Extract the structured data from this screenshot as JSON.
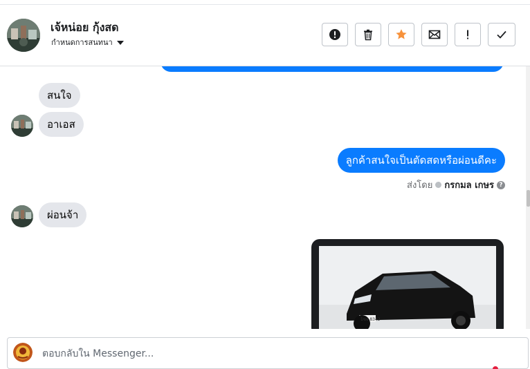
{
  "header": {
    "contact_name": "เจ้หน่อย กุ้งสด",
    "assign_label": "กำหนดการสนทนา"
  },
  "toolbar": {
    "buttons": [
      {
        "name": "follow-up-button",
        "icon": "alert-circle-icon"
      },
      {
        "name": "delete-button",
        "icon": "trash-icon"
      },
      {
        "name": "star-button",
        "icon": "star-icon"
      },
      {
        "name": "mark-unread-button",
        "icon": "envelope-icon"
      },
      {
        "name": "spam-button",
        "icon": "exclamation-icon"
      },
      {
        "name": "done-button",
        "icon": "check-icon"
      }
    ],
    "star_color": "#f7923b"
  },
  "messages": {
    "in_1": "สนใจ",
    "in_2": "อาเอส",
    "out_1": "ลูกค้าสนใจเป็นตัดสดหรือผ่อนดีคะ",
    "sent_by_prefix": "ส่งโดย",
    "sent_by_name": "กรกมล เกษร",
    "in_3": "ผ่อนจ้า",
    "car_plate": "1ขจ 8342"
  },
  "composer": {
    "placeholder": "ตอบกลับใน Messenger..."
  },
  "colors": {
    "outgoing_bubble": "#0a7cff",
    "incoming_bubble": "#e4e6eb"
  }
}
